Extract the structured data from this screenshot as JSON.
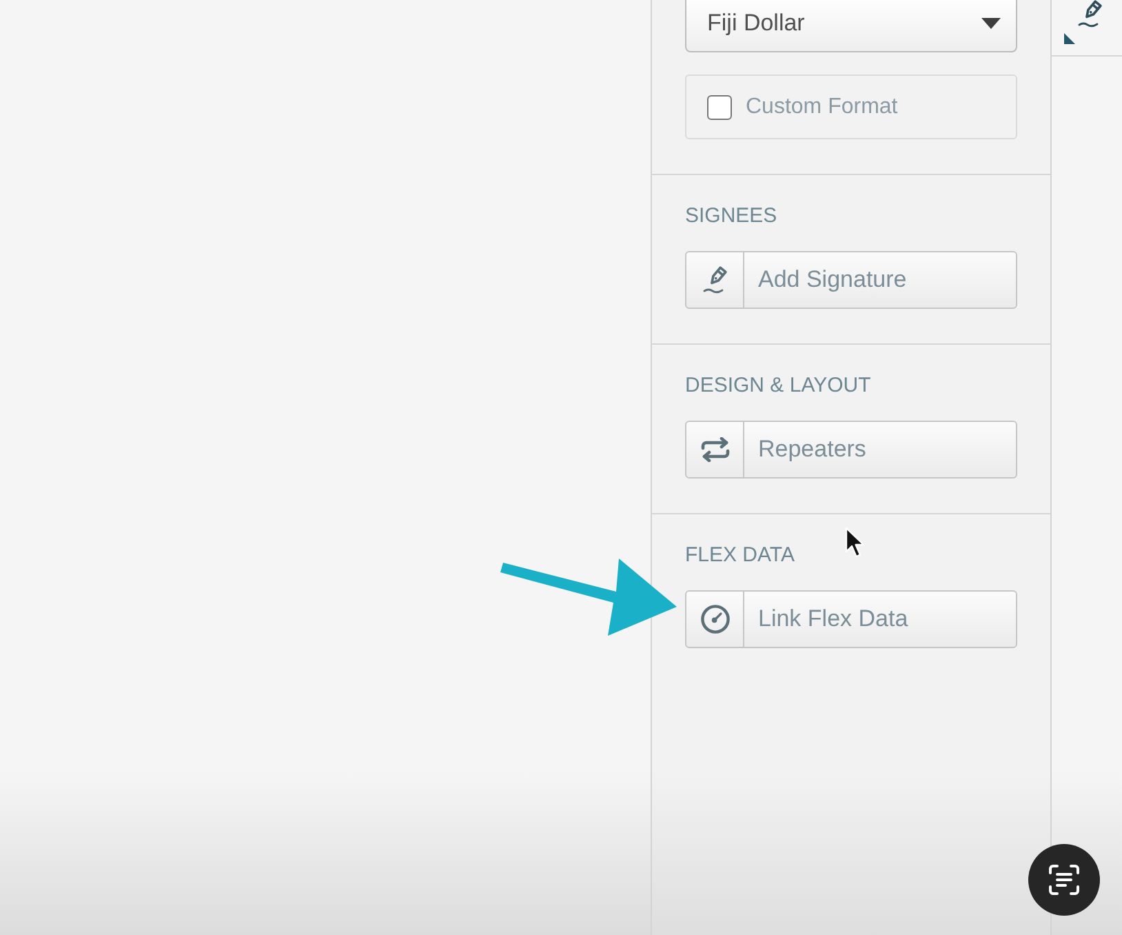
{
  "currency_select": {
    "value": "Fiji Dollar"
  },
  "custom_format": {
    "label": "Custom Format",
    "checked": false
  },
  "sections": [
    {
      "heading": "SIGNEES",
      "button": {
        "kind": "signature",
        "label": "Add Signature"
      }
    },
    {
      "heading": "DESIGN & LAYOUT",
      "button": {
        "kind": "repeat",
        "label": "Repeaters"
      }
    },
    {
      "heading": "FLEX DATA",
      "button": {
        "kind": "link",
        "label": "Link Flex Data"
      }
    }
  ]
}
